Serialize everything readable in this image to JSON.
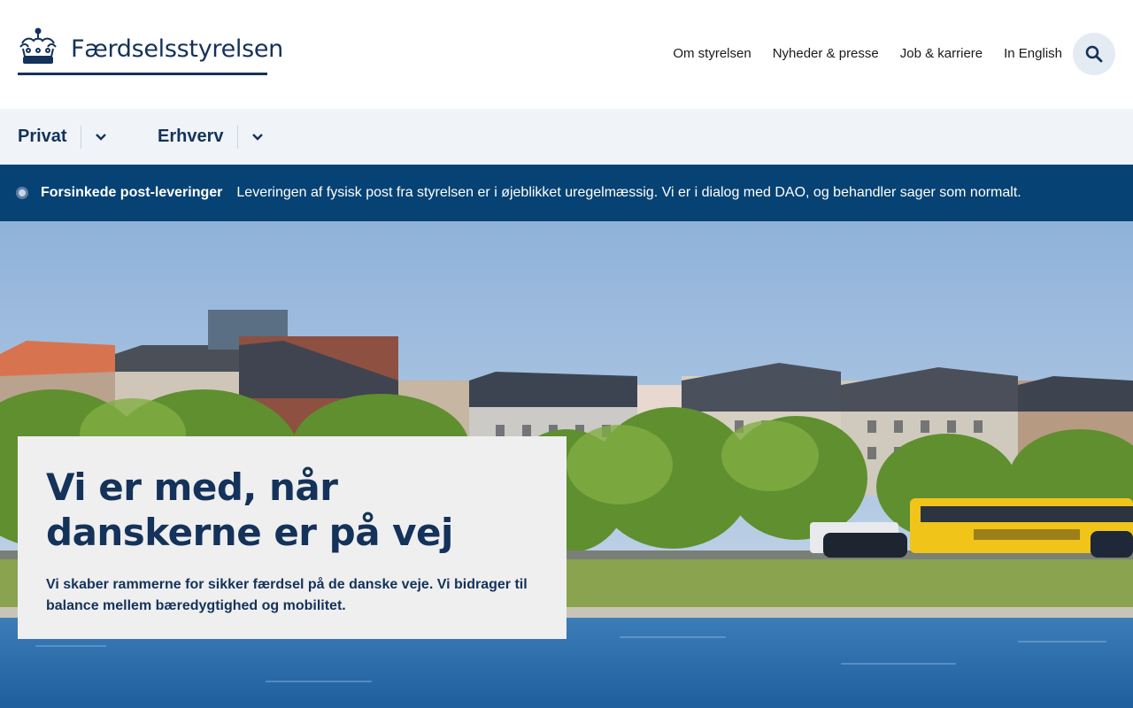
{
  "header": {
    "logo_text": "Færdselsstyrelsen",
    "nav": [
      "Om styrelsen",
      "Nyheder & presse",
      "Job & karriere",
      "In English"
    ],
    "search_icon": "search-icon"
  },
  "mainnav": {
    "items": [
      {
        "label": "Privat"
      },
      {
        "label": "Erhverv"
      }
    ]
  },
  "alert": {
    "title": "Forsinkede post-leveringer",
    "text": "Leveringen af fysisk post fra styrelsen er i øjeblikket uregelmæssig. Vi er i dialog med DAO, og behandler sager som normalt."
  },
  "hero": {
    "title": "Vi er med, når danskerne er på vej",
    "subtitle": "Vi skaber rammerne for sikker færdsel på de danske veje. Vi bidrager til balance mellem bæredygtighed og mobilitet."
  },
  "colors": {
    "brand": "#14325a",
    "alert_bg": "#064273",
    "nav_bg": "#f0f4f8"
  }
}
